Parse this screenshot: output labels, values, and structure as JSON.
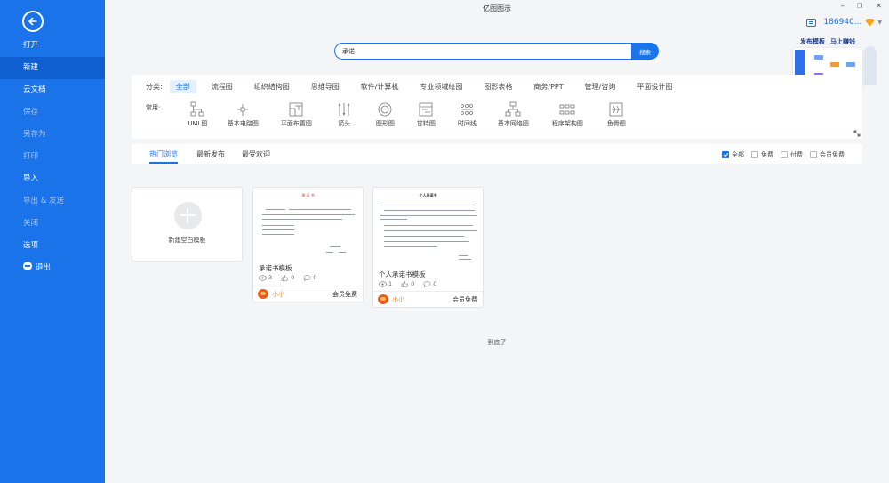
{
  "app": {
    "title": "亿图图示"
  },
  "window": {
    "minimize": "–",
    "restore": "❐",
    "close": "✕"
  },
  "user": {
    "name": "186940...",
    "caret": "▼"
  },
  "sidebar": {
    "items": [
      {
        "label": "打开"
      },
      {
        "label": "新建"
      },
      {
        "label": "云文档"
      },
      {
        "label": "保存"
      },
      {
        "label": "另存为"
      },
      {
        "label": "打印"
      },
      {
        "label": "导入"
      },
      {
        "label": "导出 & 发送"
      },
      {
        "label": "关闭"
      },
      {
        "label": "选项"
      },
      {
        "label": "退出"
      }
    ],
    "active_index": 1
  },
  "search": {
    "value": "承诺",
    "button": "搜索"
  },
  "promo": {
    "publish": "发布模板",
    "earn": "马上赚钱"
  },
  "categories": {
    "label": "分类:",
    "items": [
      "全部",
      "流程图",
      "组织结构图",
      "思维导图",
      "软件/计算机",
      "专业领域绘图",
      "图形表格",
      "商务/PPT",
      "管理/咨询",
      "平面设计图"
    ],
    "active": "全部"
  },
  "common": {
    "label": "常用:",
    "items": [
      {
        "label": "UML图",
        "icon": "uml-icon"
      },
      {
        "label": "基本电路图",
        "icon": "circuit-icon"
      },
      {
        "label": "平面布置图",
        "icon": "floor-plan-icon"
      },
      {
        "label": "箭头",
        "icon": "arrow-icon"
      },
      {
        "label": "图形图",
        "icon": "shape-icon"
      },
      {
        "label": "甘特图",
        "icon": "gantt-icon"
      },
      {
        "label": "时间线",
        "icon": "timeline-icon"
      },
      {
        "label": "基本网络图",
        "icon": "network-icon"
      },
      {
        "label": "程序架构图",
        "icon": "architecture-icon"
      },
      {
        "label": "鱼骨图",
        "icon": "fishbone-icon"
      }
    ]
  },
  "tabs": [
    "热门浏览",
    "最新发布",
    "最受欢迎"
  ],
  "filters": [
    {
      "label": "全部",
      "checked": true
    },
    {
      "label": "免费",
      "checked": false
    },
    {
      "label": "付费",
      "checked": false
    },
    {
      "label": "会员免费",
      "checked": false
    }
  ],
  "new_blank": "新建空白模板",
  "templates": [
    {
      "doc_title": "承 诺 书",
      "name": "承诺书模板",
      "views": "3",
      "likes": "0",
      "comments": "0",
      "author": "小小",
      "price": "会员免费"
    },
    {
      "doc_title": "个人承诺书",
      "name": "个人承诺书模板",
      "views": "1",
      "likes": "0",
      "comments": "0",
      "author": "小小",
      "price": "会员免费"
    }
  ],
  "end_text": "到底了"
}
